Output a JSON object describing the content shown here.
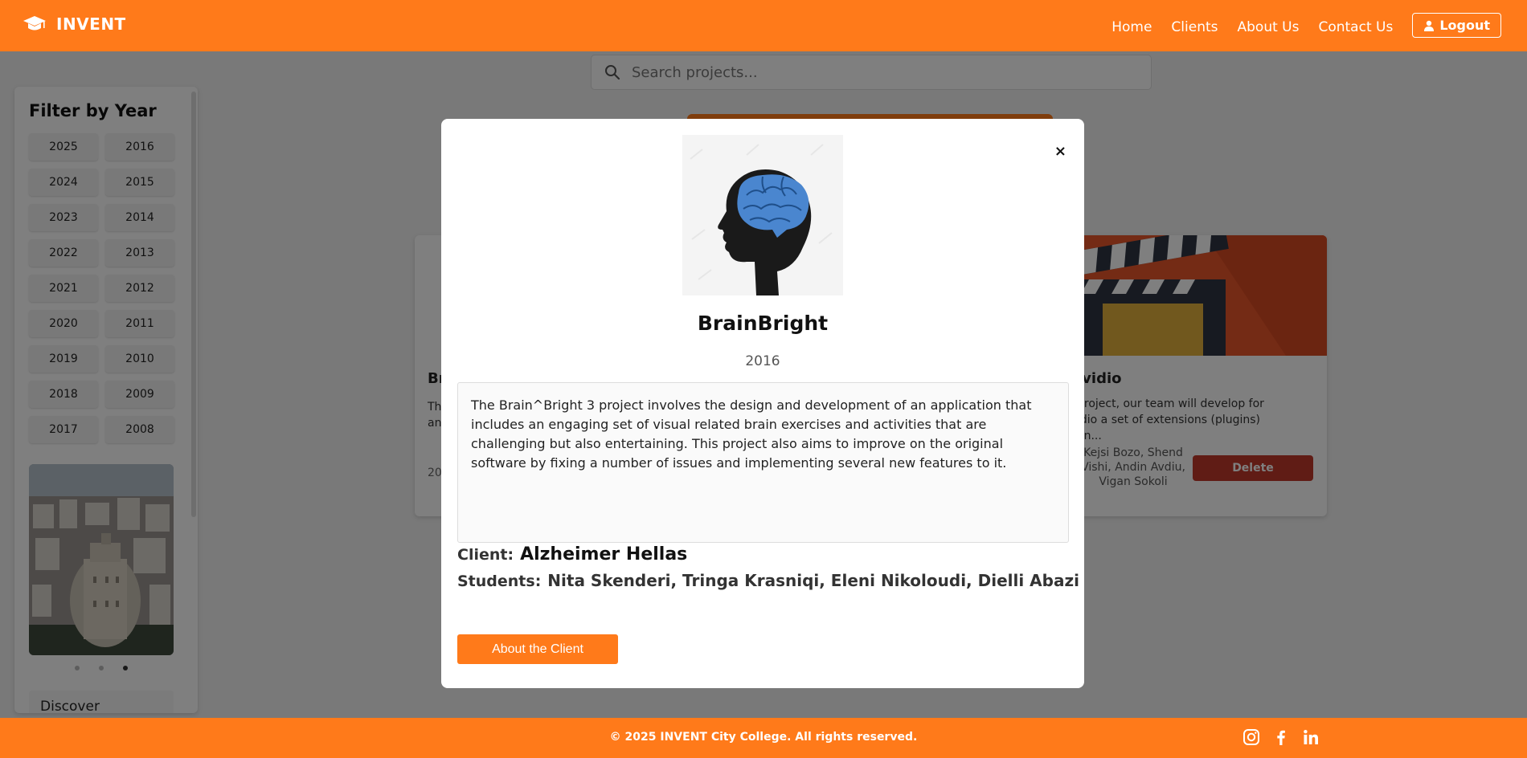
{
  "header": {
    "brand": "INVENT",
    "nav": [
      "Home",
      "Clients",
      "About Us",
      "Contact Us"
    ],
    "logout": "Logout"
  },
  "search": {
    "placeholder": "Search projects..."
  },
  "sidebar": {
    "title": "Filter by Year",
    "years": [
      "2025",
      "2016",
      "2024",
      "2015",
      "2023",
      "2014",
      "2022",
      "2013",
      "2021",
      "2012",
      "2020",
      "2011",
      "2019",
      "2010",
      "2018",
      "2009",
      "2017",
      "2008"
    ],
    "discover": "Discover"
  },
  "cards": {
    "left": {
      "title": "Br",
      "desc_line1": "Th",
      "desc_line2": "an",
      "year": "20"
    },
    "right": {
      "title": "lvidio",
      "desc_line1": "project, our team will develop for",
      "desc_line2": "idio a set of extensions (plugins) on...",
      "students": "Kejsi Bozo, Shend Vishi, Andin Avdiu, Vigan Sokoli",
      "delete": "Delete"
    }
  },
  "modal": {
    "close": "×",
    "title": "BrainBright",
    "year": "2016",
    "description": "The Brain^Bright 3 project involves the design and development of an application that includes an engaging set of visual related brain exercises and activities that are challenging but also entertaining. This project also aims to improve on the original software by fixing a number of issues and implementing several new features to it.",
    "client_label": "Client:",
    "client": "Alzheimer Hellas",
    "students_label": "Students:",
    "students": "Nita Skenderi, Tringa Krasniqi, Eleni Nikoloudi, Dielli Abazi",
    "about_button": "About the Client"
  },
  "footer": {
    "copyright": "© 2025 INVENT City College. All rights reserved.",
    "socials": [
      "instagram-icon",
      "facebook-icon",
      "linkedin-icon"
    ]
  },
  "colors": {
    "accent": "#ff7a1a",
    "danger": "#c0392b",
    "overlay": "rgba(0,0,0,0.5)"
  }
}
